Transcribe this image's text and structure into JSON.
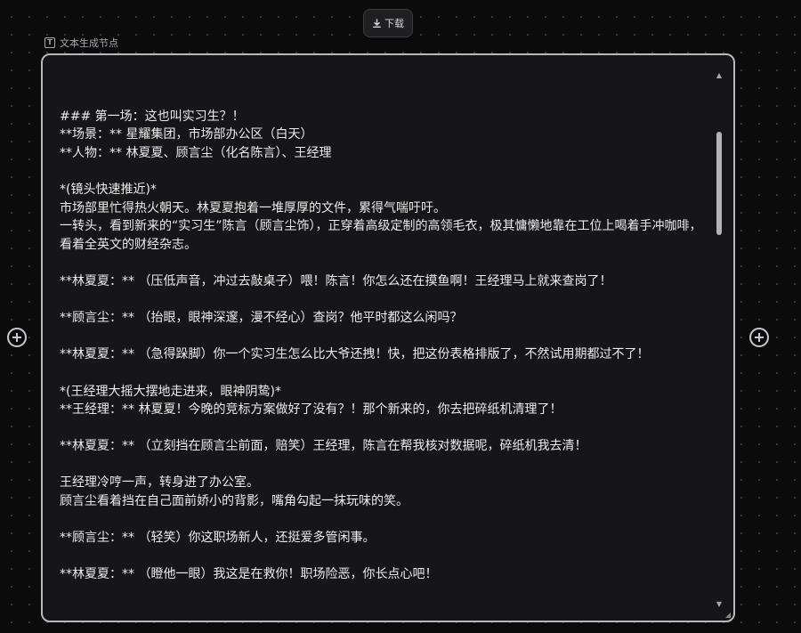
{
  "toolbar": {
    "download_label": "下载",
    "download_icon": "download-icon"
  },
  "node": {
    "type_label": "文本生成节点",
    "type_icon": "text-t-icon",
    "lines": [
      "",
      "### 第一场：这也叫实习生？！",
      "**场景：** 星耀集团，市场部办公区（白天）",
      "**人物：** 林夏夏、顾言尘（化名陈言）、王经理",
      "",
      "*(镜头快速推近)*",
      "市场部里忙得热火朝天。林夏夏抱着一堆厚厚的文件，累得气喘吁吁。",
      "一转头，看到新来的“实习生”陈言（顾言尘饰），正穿着高级定制的高领毛衣，极其慵懒地靠在工位上喝着手冲咖啡，看着全英文的财经杂志。",
      "",
      "**林夏夏：** （压低声音，冲过去敲桌子）喂！陈言！你怎么还在摸鱼啊！王经理马上就来查岗了！",
      "",
      "**顾言尘：** （抬眼，眼神深邃，漫不经心）查岗？他平时都这么闲吗？",
      "",
      "**林夏夏：** （急得跺脚）你一个实习生怎么比大爷还拽！快，把这份表格排版了，不然试用期都过不了！",
      "",
      "*(王经理大摇大摆地走进来，眼神阴鸷)*",
      "**王经理：** 林夏夏！今晚的竞标方案做好了没有？！那个新来的，你去把碎纸机清理了！",
      "",
      "**林夏夏：** （立刻挡在顾言尘前面，赔笑）王经理，陈言在帮我核对数据呢，碎纸机我去清！",
      "",
      "王经理冷哼一声，转身进了办公室。",
      "顾言尘看着挡在自己面前娇小的背影，嘴角勾起一抹玩味的笑。",
      "",
      "**顾言尘：** （轻笑）你这职场新人，还挺爱多管闲事。",
      "",
      "**林夏夏：** （瞪他一眼）我这是在救你！职场险恶，你长点心吧！",
      "",
      "---"
    ]
  },
  "handles": {
    "left_icon": "add-circle-icon",
    "right_icon": "add-circle-icon"
  },
  "colors": {
    "background": "#0b0b0c",
    "card_border": "#b8b8bc",
    "card_background": "#161618",
    "text": "#ececec"
  }
}
